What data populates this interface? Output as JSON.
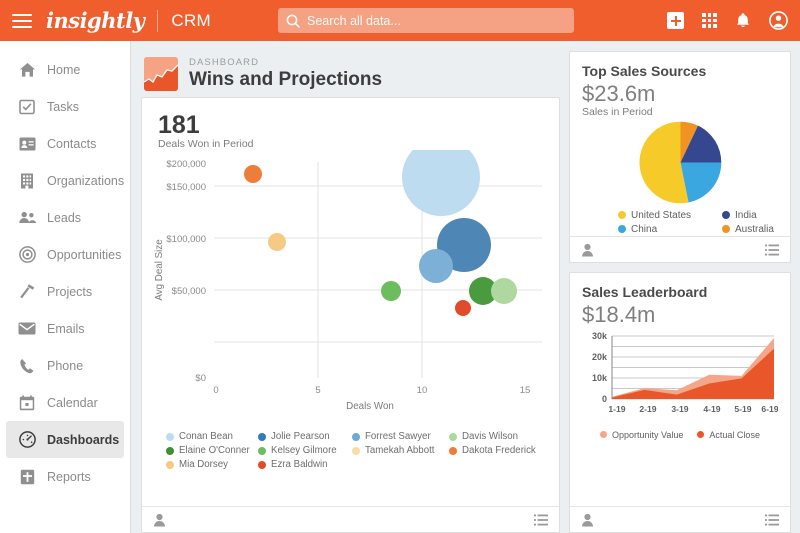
{
  "topbar": {
    "brand": "insightly",
    "product": "CRM",
    "search_placeholder": "Search all data...",
    "search_value": "",
    "icons": [
      "menu-icon",
      "search-icon",
      "add-icon",
      "apps-grid-icon",
      "notifications-bell-icon",
      "user-account-icon"
    ],
    "bg_color": "#ef5e2c",
    "search_bg": "#f4a283"
  },
  "sidebar": {
    "items": [
      {
        "label": "Home",
        "icon": "home-icon",
        "active": false
      },
      {
        "label": "Tasks",
        "icon": "checkbox-task-icon",
        "active": false
      },
      {
        "label": "Contacts",
        "icon": "contact-card-icon",
        "active": false
      },
      {
        "label": "Organizations",
        "icon": "building-icon",
        "active": false
      },
      {
        "label": "Leads",
        "icon": "people-icon",
        "active": false
      },
      {
        "label": "Opportunities",
        "icon": "target-icon",
        "active": false
      },
      {
        "label": "Projects",
        "icon": "hammer-icon",
        "active": false
      },
      {
        "label": "Emails",
        "icon": "envelope-icon",
        "active": false
      },
      {
        "label": "Phone",
        "icon": "phone-icon",
        "active": false
      },
      {
        "label": "Calendar",
        "icon": "calendar-icon",
        "active": false
      },
      {
        "label": "Dashboards",
        "icon": "gauge-icon",
        "active": true
      },
      {
        "label": "Reports",
        "icon": "report-icon",
        "active": false
      }
    ]
  },
  "header": {
    "kicker": "DASHBOARD",
    "title": "Wins and Projections",
    "icon": "area-chart-icon",
    "icon_bg": "#f6a384"
  },
  "cards": {
    "bubble": {
      "value": "181",
      "value_label": "Deals Won in Period",
      "footer_left_icon": "person-icon",
      "footer_right_icon": "list-icon"
    },
    "sales_sources": {
      "title": "Top Sales Sources",
      "amount": "$23.6m",
      "amount_label": "Sales in Period",
      "footer_left_icon": "person-icon",
      "footer_right_icon": "list-icon"
    },
    "leaderboard": {
      "title": "Sales Leaderboard",
      "amount": "$18.4m",
      "footer_left_icon": "person-icon",
      "footer_right_icon": "list-icon"
    }
  },
  "chart_data": [
    {
      "type": "scatter",
      "name": "wins-and-projections-bubble",
      "title": "Deals Won in Period",
      "xlabel": "Deals Won",
      "ylabel": "Avg Deal Size",
      "xlim": [
        0,
        15
      ],
      "ylim": [
        0,
        212000
      ],
      "xticks": [
        "0",
        "5",
        "10",
        "15"
      ],
      "yticks": [
        "$0",
        "$50,000",
        "$100,000",
        "$150,000",
        "$200,000"
      ],
      "grid": true,
      "points": [
        {
          "name": "Conan Bean",
          "x": 10.9,
          "y": 160000,
          "size": 118,
          "color": "#bedcf0"
        },
        {
          "name": "Jolie Pearson",
          "x": 12.0,
          "y": 95000,
          "size": 80,
          "color": "#4e87b5"
        },
        {
          "name": "Forrest Sawyer",
          "x": 11.0,
          "y": 75000,
          "size": 49,
          "color": "#7cb0d6"
        },
        {
          "name": "Davis Wilson",
          "x": 14.0,
          "y": 49000,
          "size": 38,
          "color": "#aed89f"
        },
        {
          "name": "Elaine O'Conner",
          "x": 13.0,
          "y": 49000,
          "size": 42,
          "color": "#4a9b3e"
        },
        {
          "name": "Kelsey Gilmore",
          "x": 9.0,
          "y": 49000,
          "size": 30,
          "color": "#6cbd5e"
        },
        {
          "name": "Tamekah Abbott",
          "x": 2.95,
          "y": 124000,
          "size": 27,
          "color": "#f6c985"
        },
        {
          "name": "Dakota Frederick",
          "x": 1.8,
          "y": 189000,
          "size": 27,
          "color": "#ef7d3a"
        },
        {
          "name": "Mia Dorsey",
          "x": 2.95,
          "y": 124000,
          "size": 27,
          "color": "#f6c985"
        },
        {
          "name": "Ezra Baldwin",
          "x": 11.95,
          "y": 33000,
          "size": 22,
          "color": "#e04b2a"
        }
      ],
      "legend": [
        {
          "label": "Conan Bean",
          "color": "#bedcf0"
        },
        {
          "label": "Jolie Pearson",
          "color": "#2f7cb8"
        },
        {
          "label": "Forrest Sawyer",
          "color": "#6aa9d8"
        },
        {
          "label": "Davis Wilson",
          "color": "#aed89f"
        },
        {
          "label": "Elaine O'Conner",
          "color": "#3f8f33"
        },
        {
          "label": "Kelsey Gilmore",
          "color": "#6cbd5e"
        },
        {
          "label": "Tamekah Abbott",
          "color": "#f8dcaa"
        },
        {
          "label": "Dakota Frederick",
          "color": "#ef7d3a"
        },
        {
          "label": "Mia Dorsey",
          "color": "#f6c985"
        },
        {
          "label": "Ezra Baldwin",
          "color": "#e04b2a"
        }
      ]
    },
    {
      "type": "pie",
      "name": "top-sales-sources-pie",
      "title": "Top Sales Sources",
      "total": "$23.6m",
      "labels": [
        "United States",
        "China",
        "India",
        "Australia"
      ],
      "values": [
        51,
        26,
        16,
        7
      ],
      "colors": [
        "#f5ca29",
        "#3aa7e0",
        "#35488f",
        "#f29220"
      ],
      "legend_position": "bottom"
    },
    {
      "type": "area",
      "name": "sales-leaderboard-area",
      "title": "Sales Leaderboard",
      "total": "$18.4m",
      "categories": [
        "1-19",
        "2-19",
        "3-19",
        "4-19",
        "5-19",
        "6-19"
      ],
      "yticks": [
        "0",
        "10k",
        "20k",
        "30k"
      ],
      "ylim": [
        0,
        30000
      ],
      "grid": true,
      "series": [
        {
          "name": "Opportunity Value",
          "color": "#f4a68a",
          "values": [
            1000,
            5200,
            4200,
            11500,
            11000,
            29000
          ]
        },
        {
          "name": "Actual Close",
          "color": "#e8562a",
          "values": [
            700,
            4300,
            2100,
            7400,
            9800,
            24000
          ]
        }
      ]
    }
  ]
}
